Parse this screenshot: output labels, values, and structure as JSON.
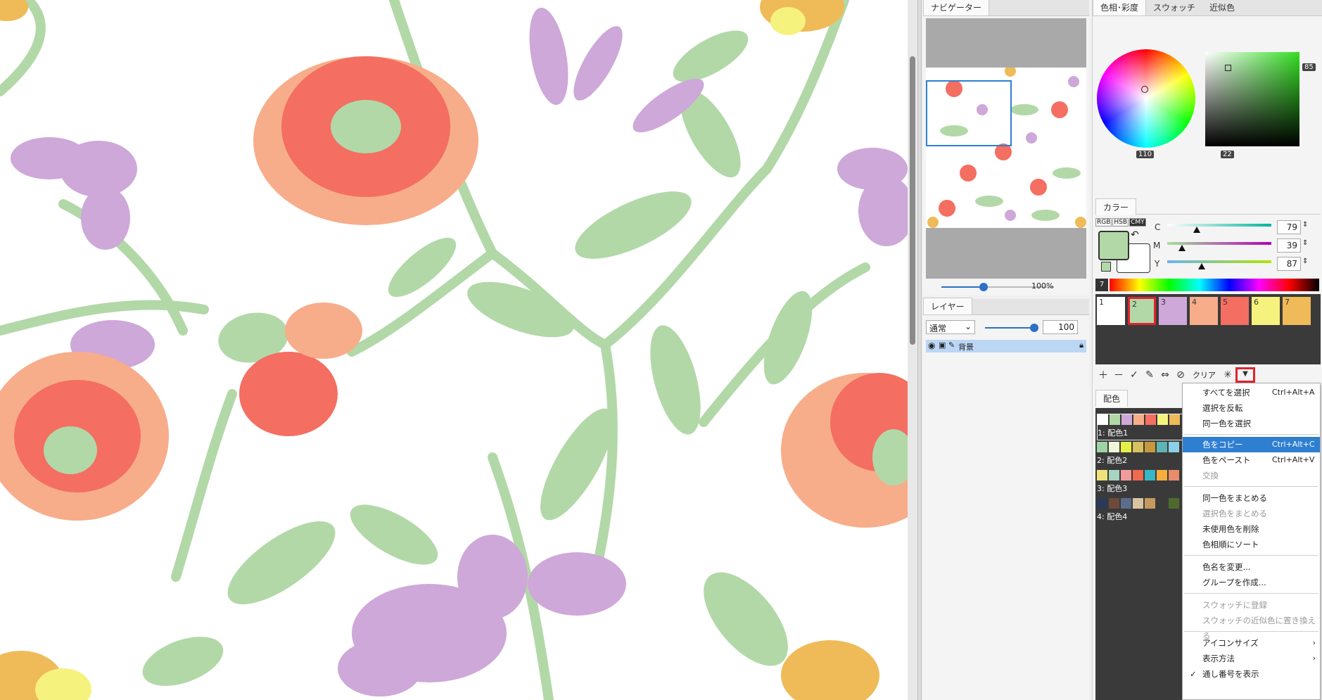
{
  "navigator": {
    "tab_label": "ナビゲーター",
    "zoom": "100%"
  },
  "layer": {
    "tab_label": "レイヤー",
    "blend_mode": "通常",
    "opacity": "100",
    "layer_name": "背景"
  },
  "color_tabs": [
    "色相･彩度",
    "スウォッチ",
    "近似色"
  ],
  "hsv": {
    "hue": "110",
    "value": "85",
    "saturation": "22"
  },
  "color_panel": {
    "tab_label": "カラー",
    "modes": [
      "RGB",
      "HSB",
      "CMY"
    ],
    "c_label": "C",
    "c_value": "79",
    "m_label": "M",
    "m_value": "39",
    "y_label": "Y",
    "y_value": "87",
    "main_color": "#b2d8a8",
    "sub_color": "#ffffff"
  },
  "palette": {
    "count": "7",
    "swatches": [
      {
        "label": "1",
        "color": "#ffffff"
      },
      {
        "label": "2",
        "color": "#b2d8a8"
      },
      {
        "label": "3",
        "color": "#cda8d8"
      },
      {
        "label": "4",
        "color": "#f7ad8a"
      },
      {
        "label": "5",
        "color": "#f46e61"
      },
      {
        "label": "6",
        "color": "#f6f27e"
      },
      {
        "label": "7",
        "color": "#efba58"
      }
    ],
    "clear_label": "クリア"
  },
  "haishoku": {
    "tab_label": "配色",
    "rows": [
      {
        "label": "1: 配色1",
        "colors": [
          "#ffffff",
          "#b2d8a8",
          "#cda8d8",
          "#f7ad8a",
          "#f46e61",
          "#f6f27e",
          "#efba58"
        ]
      },
      {
        "label": "2: 配色2",
        "colors": [
          "#9ed3a4",
          "#f0f6d8",
          "#e6ef48",
          "#d9c060",
          "#c69a3c",
          "#5fb5b5",
          "#8bd0e8"
        ]
      },
      {
        "label": "3: 配色3",
        "colors": [
          "#efe279",
          "#a8d4c0",
          "#f29b9b",
          "#ef6a4e",
          "#37b6c6",
          "#f7ae3e",
          "#e88c6a"
        ]
      },
      {
        "label": "4: 配色4",
        "colors": [
          "#2b3a5a",
          "#6d4a3a",
          "#5b6d8a",
          "#d9c4a2",
          "#c69a5e",
          "#3a3a3a",
          "#4e6a2c"
        ]
      }
    ]
  },
  "context_menu": {
    "items": [
      {
        "label": "すべてを選択",
        "shortcut": "Ctrl+Alt+A"
      },
      {
        "label": "選択を反転",
        "shortcut": ""
      },
      {
        "label": "同一色を選択",
        "shortcut": ""
      },
      {
        "label": "色をコピー",
        "shortcut": "Ctrl+Alt+C"
      },
      {
        "label": "色をペースト",
        "shortcut": "Ctrl+Alt+V"
      },
      {
        "label": "交換",
        "shortcut": ""
      },
      {
        "label": "同一色をまとめる",
        "shortcut": ""
      },
      {
        "label": "選択色をまとめる",
        "shortcut": ""
      },
      {
        "label": "未使用色を削除",
        "shortcut": ""
      },
      {
        "label": "色相順にソート",
        "shortcut": ""
      },
      {
        "label": "色名を変更...",
        "shortcut": ""
      },
      {
        "label": "グループを作成...",
        "shortcut": ""
      },
      {
        "label": "スウォッチに登録",
        "shortcut": ""
      },
      {
        "label": "スウォッチの近似色に置き換える",
        "shortcut": ""
      },
      {
        "label": "アイコンサイズ",
        "shortcut": ""
      },
      {
        "label": "表示方法",
        "shortcut": ""
      },
      {
        "label": "通し番号を表示",
        "shortcut": ""
      }
    ]
  }
}
